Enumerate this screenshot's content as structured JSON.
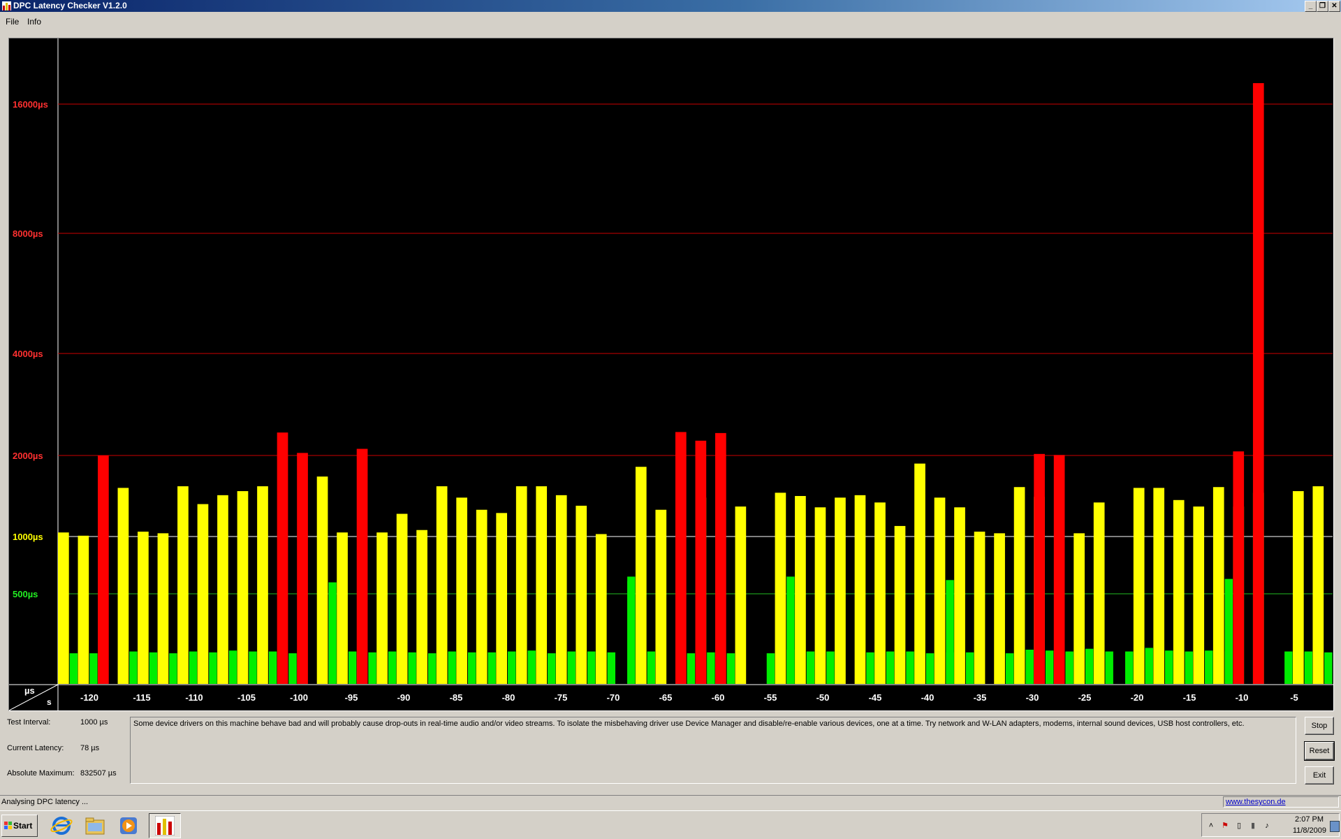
{
  "window": {
    "title": "DPC Latency Checker V1.2.0"
  },
  "menu": {
    "items": [
      "File",
      "Info"
    ]
  },
  "chart_data": {
    "type": "bar",
    "title": "",
    "xlabel": "s",
    "ylabel": "µs",
    "x_ticks": [
      "-120",
      "-115",
      "-110",
      "-105",
      "-100",
      "-95",
      "-90",
      "-85",
      "-80",
      "-75",
      "-70",
      "-65",
      "-60",
      "-55",
      "-50",
      "-45",
      "-40",
      "-35",
      "-30",
      "-25",
      "-20",
      "-15",
      "-10",
      "-5"
    ],
    "y_ticks": [
      "16000µs",
      "8000µs",
      "4000µs",
      "2000µs",
      "1000µs",
      "500µs"
    ],
    "grid_colors": {
      "red": "#cc0000",
      "white": "#ffffff",
      "green": "#22bb22"
    },
    "bar_colors": {
      "yellow": "#ffff00",
      "green": "#00ee00",
      "red": "#ff0000"
    },
    "series": [
      {
        "name": "yellow",
        "values": [
          1050,
          1010,
          0,
          1600,
          1060,
          1040,
          1620,
          1400,
          1510,
          1560,
          1620,
          0,
          0,
          1740,
          1050,
          0,
          1050,
          1280,
          1080,
          1620,
          1480,
          1330,
          1290,
          1620,
          1620,
          1510,
          1380,
          1030,
          0,
          1860,
          1330,
          0,
          1480,
          0,
          1370,
          0,
          1540,
          1500,
          1360,
          1480,
          1510,
          1420,
          1130,
          1900,
          1480,
          1360,
          1060,
          1040,
          1610,
          1490,
          0,
          1040,
          1420,
          0,
          1600,
          1600,
          1450,
          1370,
          1610,
          1370,
          1540,
          0,
          1560,
          1620
        ]
      },
      {
        "name": "green",
        "values": [
          170,
          170,
          0,
          180,
          175,
          170,
          180,
          175,
          185,
          180,
          180,
          170,
          0,
          0,
          180,
          175,
          180,
          175,
          170,
          180,
          175,
          175,
          180,
          185,
          170,
          180,
          180,
          175,
          610,
          180,
          0,
          170,
          175,
          170,
          0,
          170,
          190,
          180,
          180,
          0,
          175,
          180,
          180,
          170,
          175,
          175,
          0,
          170,
          190,
          185,
          180,
          195,
          180,
          180,
          200,
          185,
          180,
          185,
          180,
          0,
          0,
          180,
          180,
          175
        ]
      },
      {
        "name": "red",
        "values": [
          0,
          0,
          2000,
          0,
          0,
          0,
          0,
          0,
          0,
          0,
          0,
          2450,
          2050,
          0,
          0,
          2130,
          0,
          0,
          0,
          0,
          0,
          0,
          0,
          0,
          0,
          0,
          0,
          0,
          0,
          0,
          0,
          2460,
          2290,
          2440,
          0,
          0,
          0,
          0,
          0,
          0,
          0,
          0,
          0,
          0,
          0,
          0,
          0,
          0,
          0,
          2030,
          2010,
          0,
          0,
          0,
          0,
          0,
          0,
          0,
          0,
          2080,
          17500,
          0,
          0,
          0
        ]
      },
      {
        "name": "peaks",
        "values": [
          0,
          0,
          0,
          0,
          0,
          0,
          0,
          0,
          0,
          0,
          0,
          0,
          0,
          0,
          0,
          0,
          0,
          0,
          0,
          0,
          0,
          0,
          0,
          0,
          0,
          0,
          0,
          0,
          0,
          0,
          0,
          0,
          0,
          0,
          0,
          0,
          0,
          0,
          0,
          0,
          0,
          0,
          0,
          0,
          0,
          0,
          0,
          0,
          0,
          0,
          0,
          0,
          0,
          0,
          0,
          0,
          0,
          0,
          0,
          0,
          0,
          0,
          0,
          0
        ]
      }
    ],
    "extra_green_tall": {
      "indices": [
        13,
        28,
        36,
        44,
        58
      ],
      "values": [
        600,
        650,
        650,
        620,
        630
      ]
    },
    "extra_yellow_pair": {
      "indices": [
        14
      ],
      "values": [
        1190
      ]
    }
  },
  "info": {
    "test_interval_label": "Test Interval:",
    "test_interval_value": "1000 µs",
    "current_latency_label": "Current Latency:",
    "current_latency_value": "78 µs",
    "absolute_maximum_label": "Absolute Maximum:",
    "absolute_maximum_value": "832507 µs",
    "message": "Some device drivers on this machine behave bad and will probably cause drop-outs in real-time audio and/or video streams. To isolate the misbehaving driver use Device Manager and disable/re-enable various devices, one at a time. Try network and W-LAN adapters, modems, internal sound devices, USB host controllers, etc."
  },
  "buttons": {
    "stop": "Stop",
    "reset": "Reset",
    "exit": "Exit"
  },
  "status": {
    "text": "Analysing DPC latency ...",
    "link": "www.thesycon.de"
  },
  "taskbar": {
    "start_label": "Start",
    "icons": [
      "internet-explorer-icon",
      "windows-explorer-icon",
      "media-player-icon",
      "dpc-latency-checker-icon"
    ],
    "clock_time": "2:07 PM",
    "clock_date": "11/8/2009"
  }
}
